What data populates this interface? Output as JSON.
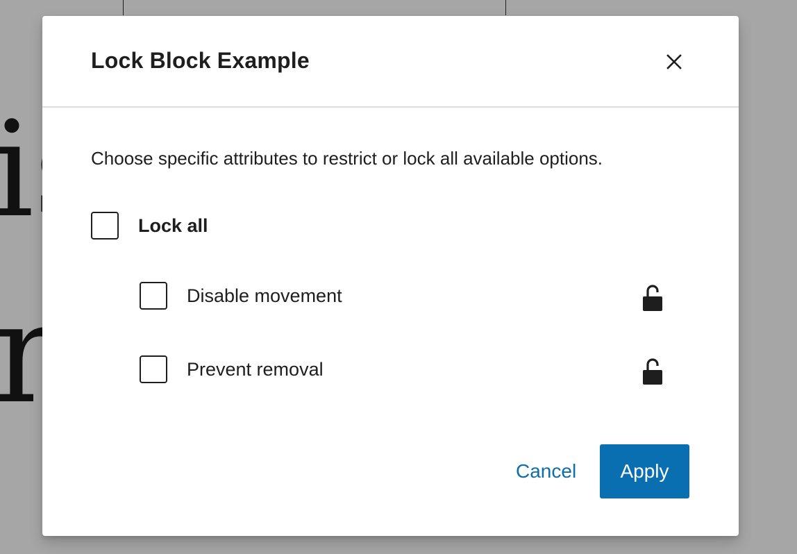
{
  "background": {
    "glyph_top": "is",
    "glyph_bottom": "np"
  },
  "modal": {
    "title": "Lock Block Example",
    "close_icon": "close-icon",
    "description": "Choose specific attributes to restrict or lock all available options.",
    "lock_all": {
      "label": "Lock all",
      "checked": false
    },
    "options": [
      {
        "label": "Disable movement",
        "checked": false,
        "icon": "unlock-icon"
      },
      {
        "label": "Prevent removal",
        "checked": false,
        "icon": "unlock-icon"
      }
    ],
    "cancel_label": "Cancel",
    "apply_label": "Apply"
  },
  "colors": {
    "accent": "#0a6fb1",
    "text": "#1e1e1e",
    "overlay": "#a6a6a6"
  }
}
